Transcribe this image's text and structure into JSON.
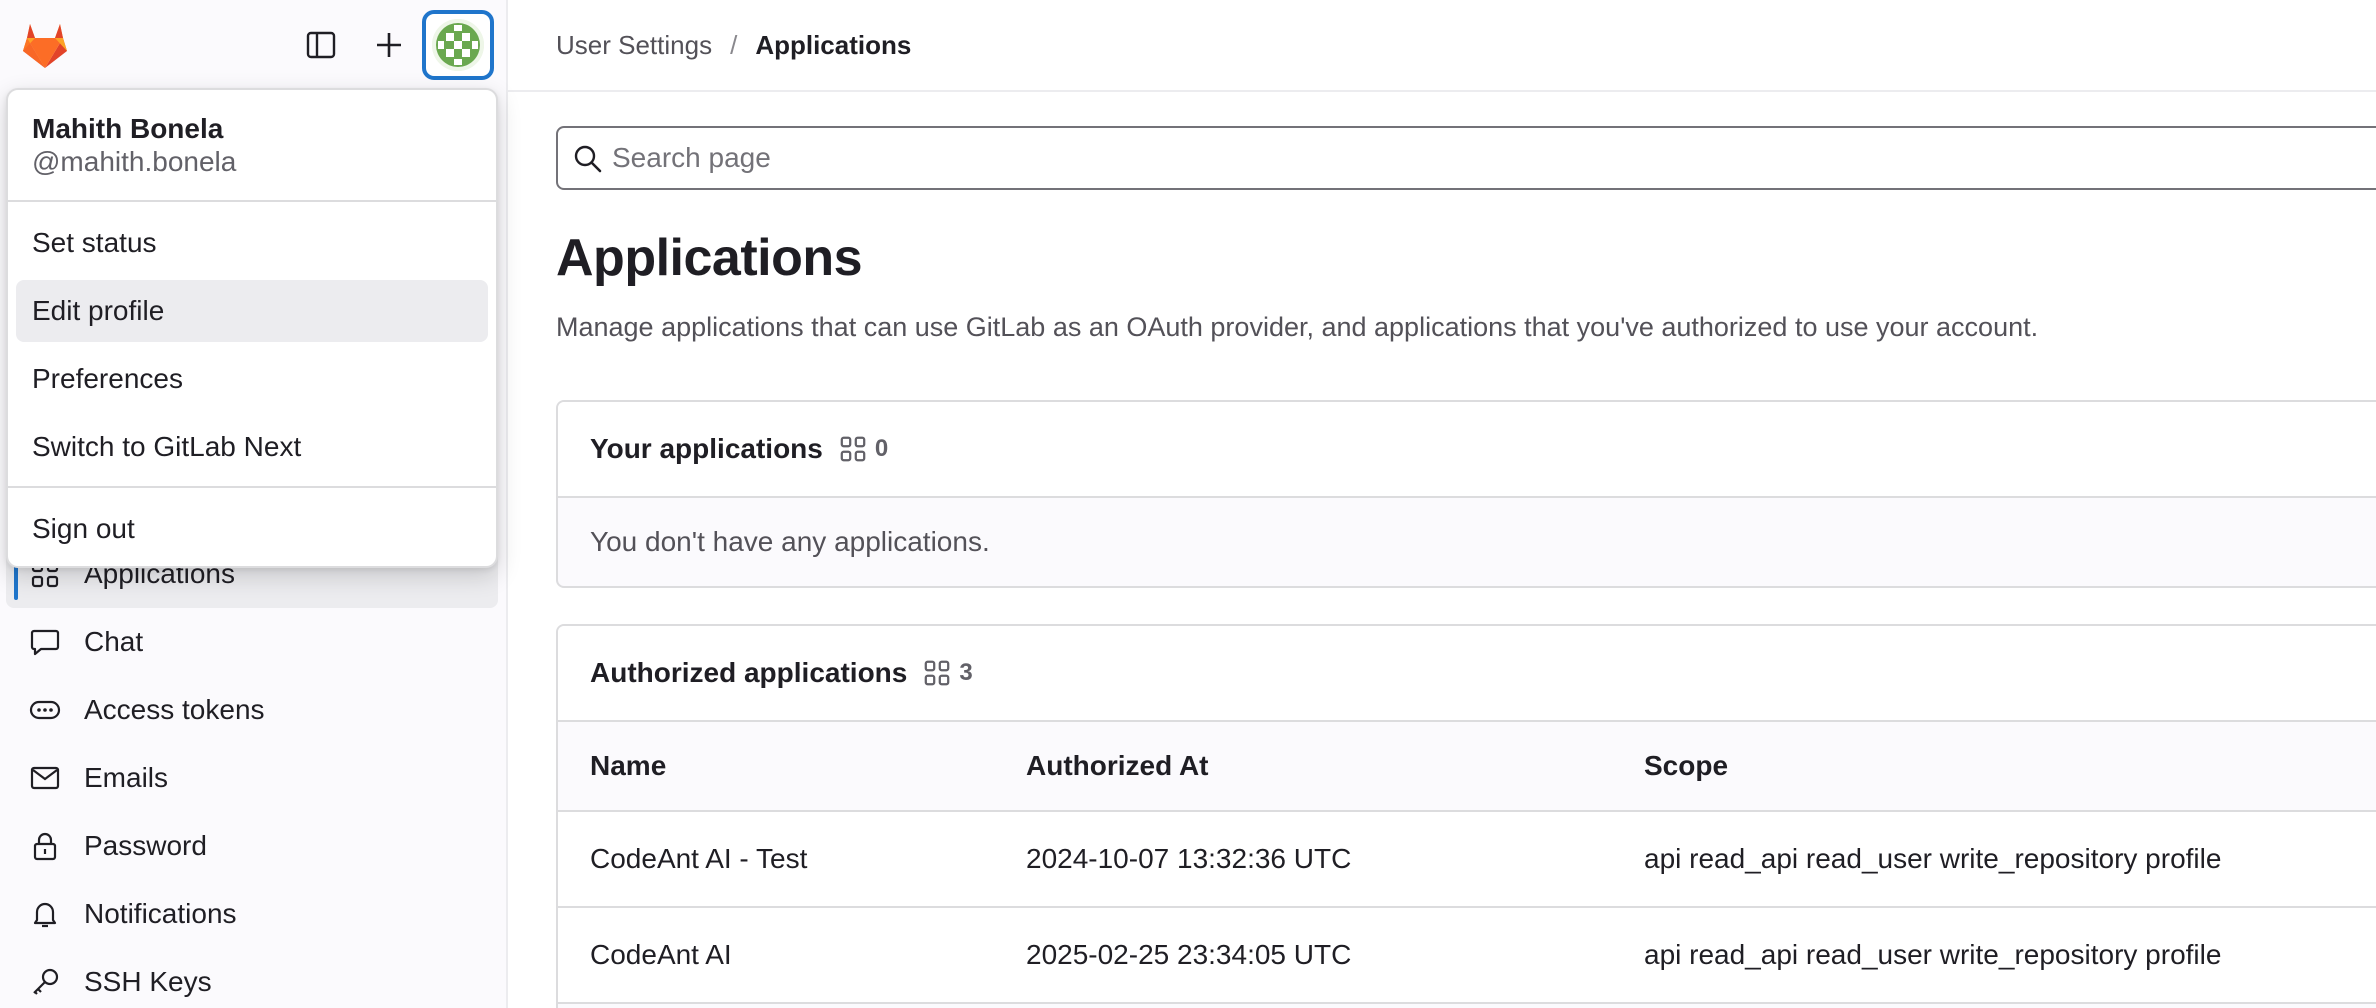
{
  "sidebar": {
    "logo": "gitlab-tanuki-logo",
    "toggle_icon": "sidebar-toggle-icon",
    "new_icon": "plus-icon",
    "avatar_icon": "user-avatar",
    "items": [
      {
        "label": "Applications",
        "icon": "applications-icon",
        "active": true
      },
      {
        "label": "Chat",
        "icon": "chat-icon"
      },
      {
        "label": "Access tokens",
        "icon": "token-icon"
      },
      {
        "label": "Emails",
        "icon": "mail-icon"
      },
      {
        "label": "Password",
        "icon": "lock-icon"
      },
      {
        "label": "Notifications",
        "icon": "bell-icon"
      },
      {
        "label": "SSH Keys",
        "icon": "key-icon"
      }
    ]
  },
  "user_menu": {
    "name": "Mahith Bonela",
    "username": "@mahith.bonela",
    "items": [
      "Set status",
      "Edit profile",
      "Preferences",
      "Switch to GitLab Next",
      "Sign out"
    ],
    "hovered": "Edit profile"
  },
  "breadcrumb": {
    "parent": "User Settings",
    "separator": "/",
    "current": "Applications"
  },
  "search": {
    "placeholder": "Search page",
    "value": ""
  },
  "page": {
    "title": "Applications",
    "description": "Manage applications that can use GitLab as an OAuth provider, and applications that you've authorized to use your account."
  },
  "your_applications": {
    "title": "Your applications",
    "count": "0",
    "empty_text": "You don't have any applications."
  },
  "authorized_applications": {
    "title": "Authorized applications",
    "count": "3",
    "columns": [
      "Name",
      "Authorized At",
      "Scope"
    ],
    "rows": [
      {
        "name": "CodeAnt AI - Test",
        "authorized_at": "2024-10-07 13:32:36 UTC",
        "scope": "api read_api read_user write_repository profile"
      },
      {
        "name": "CodeAnt AI",
        "authorized_at": "2025-02-25 23:34:05 UTC",
        "scope": "api read_api read_user write_repository profile"
      }
    ]
  },
  "colors": {
    "accent": "#1f75cb",
    "text": "#1f1e24",
    "muted": "#535158",
    "border": "#dcdcde"
  }
}
